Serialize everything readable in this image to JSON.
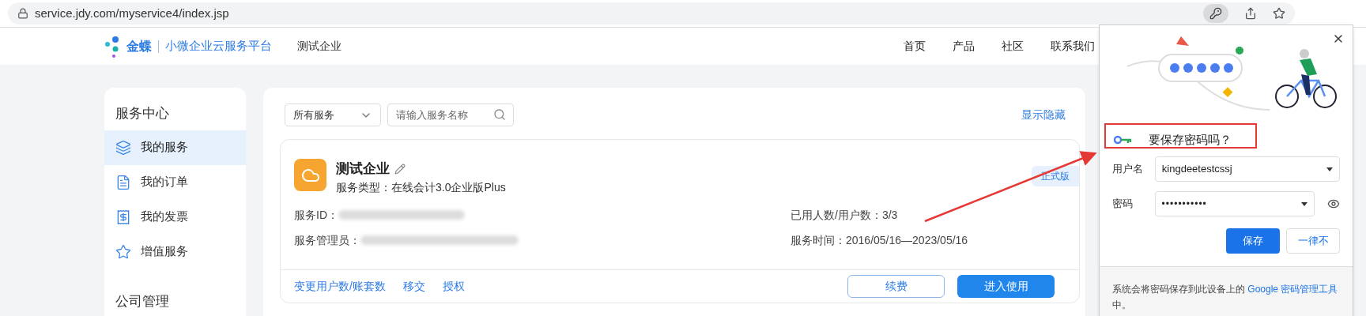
{
  "browser": {
    "url": "service.jdy.com/myservice4/index.jsp"
  },
  "header": {
    "brand": "金蝶",
    "platform": "小微企业云服务平台",
    "company": "测试企业",
    "nav": [
      "首页",
      "产品",
      "社区",
      "联系我们"
    ]
  },
  "sidebar": {
    "sections": [
      {
        "title": "服务中心",
        "items": [
          {
            "label": "我的服务",
            "kind": "layers",
            "selected": true
          },
          {
            "label": "我的订单",
            "kind": "file",
            "selected": false
          },
          {
            "label": "我的发票",
            "kind": "receipt",
            "selected": false
          },
          {
            "label": "增值服务",
            "kind": "star",
            "selected": false
          }
        ]
      },
      {
        "title": "公司管理"
      }
    ]
  },
  "toolbar": {
    "filter": {
      "value": "所有服务"
    },
    "search": {
      "placeholder": "请输入服务名称"
    },
    "toggle": "显示隐藏"
  },
  "service_card": {
    "name": "测试企业",
    "type": "服务类型：在线会计3.0企业版Plus",
    "badge": "正式版",
    "details_left": [
      {
        "label": "服务ID：",
        "redacted": true
      },
      {
        "label": "服务管理员：",
        "redacted": true
      }
    ],
    "details_right": [
      "已用人数/用户数：3/3",
      "服务时间：2016/05/16—2023/05/16"
    ],
    "links": [
      "变更用户数/账套数",
      "移交",
      "授权"
    ],
    "buttons": [
      {
        "label": "续费",
        "kind": "outline"
      },
      {
        "label": "进入使用",
        "kind": "primary"
      }
    ]
  },
  "password_popup": {
    "title": "要保存密码吗？",
    "fields": [
      {
        "label": "用户名",
        "value": "kingdeetestcssj",
        "kind": "text"
      },
      {
        "label": "密码",
        "value": "•••••••••••",
        "kind": "password"
      }
    ],
    "buttons": [
      {
        "label": "保存",
        "kind": "primary"
      },
      {
        "label": "一律不",
        "kind": "outline"
      }
    ],
    "footer": {
      "text": "系统会将密码保存到此设备上的",
      "link": "Google 密码管理工具",
      "end": "中。"
    }
  }
}
